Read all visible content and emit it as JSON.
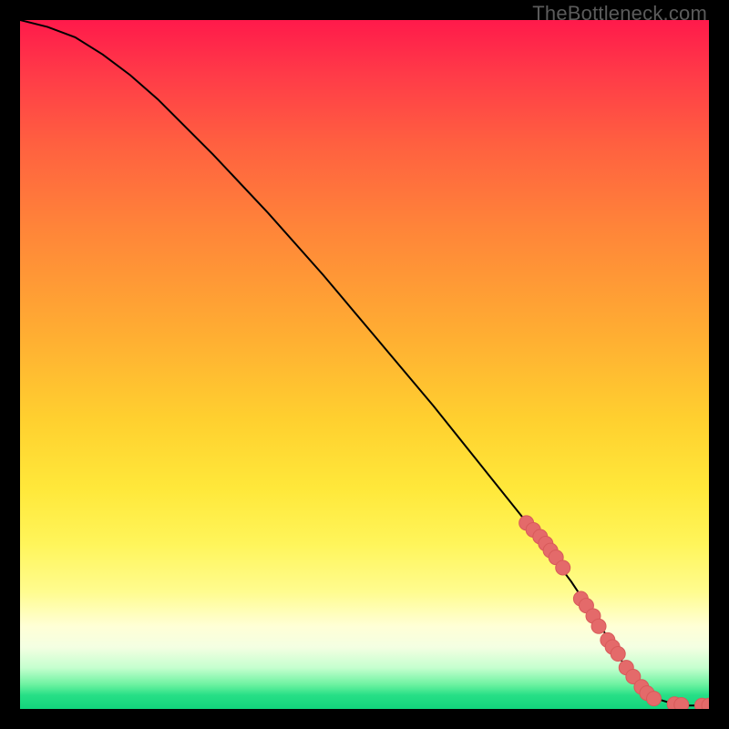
{
  "watermark": "TheBottleneck.com",
  "colors": {
    "curve_stroke": "#000000",
    "marker_fill": "#e46a6a",
    "marker_stroke": "#d85a5a",
    "border": "#000000"
  },
  "chart_data": {
    "type": "line",
    "title": "",
    "xlabel": "",
    "ylabel": "",
    "xlim": [
      0,
      100
    ],
    "ylim": [
      0,
      100
    ],
    "comment": "No axes, ticks, or labels rendered. Values are estimated from pixel positions; x runs 0→100 left→right, y runs 0→100 bottom→top.",
    "series": [
      {
        "name": "curve",
        "kind": "line",
        "x": [
          0,
          4,
          8,
          12,
          16,
          20,
          28,
          36,
          44,
          52,
          60,
          68,
          74,
          80,
          84,
          87,
          89,
          91,
          93,
          95,
          97,
          99,
          100
        ],
        "y": [
          100,
          99,
          97.5,
          95,
          92,
          88.5,
          80.5,
          72,
          63,
          53.5,
          44,
          34,
          26.5,
          18.5,
          12.5,
          7.5,
          4.5,
          2.5,
          1.3,
          0.7,
          0.5,
          0.5,
          0.5
        ]
      },
      {
        "name": "markers",
        "kind": "scatter",
        "x": [
          73.5,
          74.5,
          75.5,
          76.3,
          77.0,
          77.8,
          78.8,
          81.4,
          82.2,
          83.2,
          84.0,
          85.3,
          86.0,
          86.8,
          88.0,
          89.0,
          90.2,
          91.0,
          92.0,
          95.0,
          96.0,
          99.0,
          100.0
        ],
        "y": [
          27.0,
          26.0,
          25.0,
          24.0,
          23.0,
          22.0,
          20.5,
          16.0,
          15.0,
          13.5,
          12.0,
          10.0,
          9.0,
          8.0,
          6.0,
          4.7,
          3.2,
          2.3,
          1.5,
          0.7,
          0.6,
          0.5,
          0.5
        ]
      }
    ]
  }
}
